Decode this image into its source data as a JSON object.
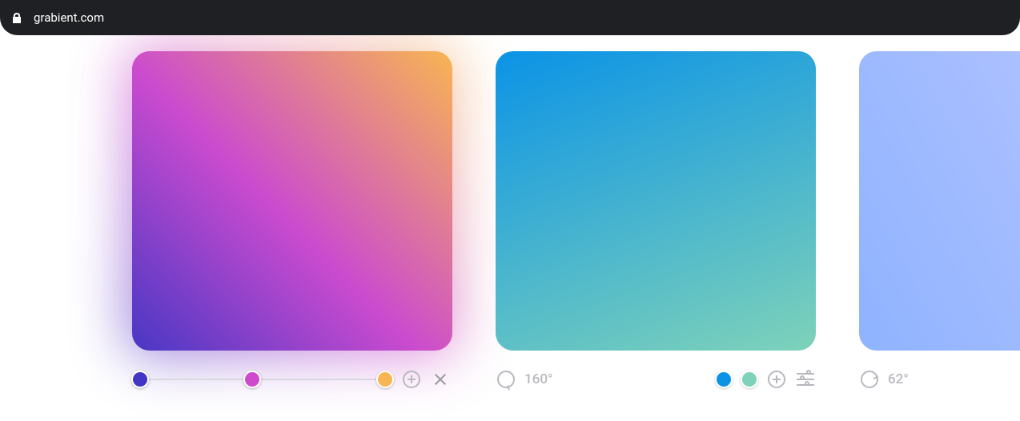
{
  "address_bar": {
    "url": "grabient.com"
  },
  "cards": [
    {
      "gradient_css": "linear-gradient(45deg, #4837c4 0%, #cb4bcf 46%, #f8b552 100%)",
      "glow": true,
      "controls": {
        "mode": "editing",
        "stops": [
          {
            "position_pct": 3,
            "color": "#4236c6"
          },
          {
            "position_pct": 46,
            "color": "#cf49cf"
          },
          {
            "position_pct": 97,
            "color": "#f7b553"
          }
        ]
      }
    },
    {
      "gradient_css": "linear-gradient(160deg, #0b93e6 0%, #7ed2b9 100%)",
      "glow": false,
      "controls": {
        "mode": "angle",
        "angle": "160°",
        "angle_deg": 160,
        "colors": [
          "#0b93e6",
          "#7ed2b9"
        ]
      }
    },
    {
      "gradient_css": "linear-gradient(62deg, #8fb3ff 0%, #b9c6ff 100%)",
      "glow": false,
      "controls": {
        "mode": "angle",
        "angle": "62°",
        "angle_deg": 62
      }
    }
  ]
}
